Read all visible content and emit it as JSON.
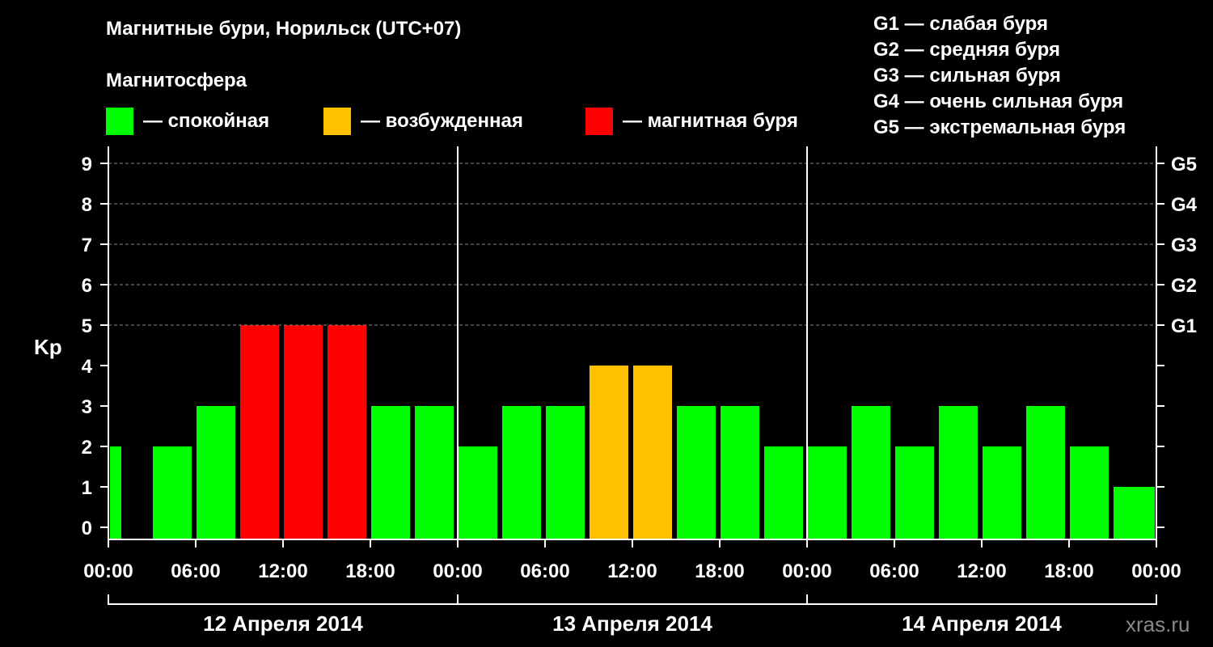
{
  "page": {
    "title": "Магнитные бури, Норильск (UTC+07)",
    "subtitle": "Магнитосфера",
    "watermark": "xras.ru"
  },
  "legend": [
    {
      "label": "— спокойная",
      "color": "#00ff00"
    },
    {
      "label": "— возбужденная",
      "color": "#ffc000"
    },
    {
      "label": "— магнитная буря",
      "color": "#ff0000"
    }
  ],
  "g_legend": [
    "G1 — слабая буря",
    "G2 — средняя буря",
    "G3 — сильная буря",
    "G4 — очень сильная буря",
    "G5 — экстремальная буря"
  ],
  "chart_data": {
    "type": "bar",
    "ylabel": "Kp",
    "ylim": [
      0,
      9
    ],
    "y_ticks": [
      "0",
      "1",
      "2",
      "3",
      "4",
      "5",
      "6",
      "7",
      "8",
      "9"
    ],
    "right_axis_ticks": [
      {
        "value": 5,
        "label": "G1"
      },
      {
        "value": 6,
        "label": "G2"
      },
      {
        "value": 7,
        "label": "G3"
      },
      {
        "value": 8,
        "label": "G4"
      },
      {
        "value": 9,
        "label": "G5"
      }
    ],
    "x_tick_labels": [
      "00:00",
      "06:00",
      "12:00",
      "18:00",
      "00:00",
      "06:00",
      "12:00",
      "18:00",
      "00:00",
      "06:00",
      "12:00",
      "18:00",
      "00:00"
    ],
    "days": [
      "12 Апреля 2014",
      "13 Апреля 2014",
      "14 Апреля 2014"
    ],
    "grid": "dashed horizontal lines at 5–9",
    "bar_hours": [
      0,
      3,
      6,
      9,
      12,
      15,
      18,
      21,
      24,
      27,
      30,
      33,
      36,
      39,
      42,
      45,
      48,
      51,
      54,
      57,
      60,
      63,
      66,
      69
    ],
    "values": [
      2,
      2,
      3,
      5,
      5,
      5,
      3,
      3,
      2,
      3,
      3,
      4,
      4,
      3,
      3,
      2,
      2,
      3,
      2,
      3,
      2,
      3,
      2,
      1,
      1
    ],
    "colors": {
      "quiet": "#00ff00",
      "excited": "#ffc000",
      "storm": "#ff0000"
    }
  }
}
